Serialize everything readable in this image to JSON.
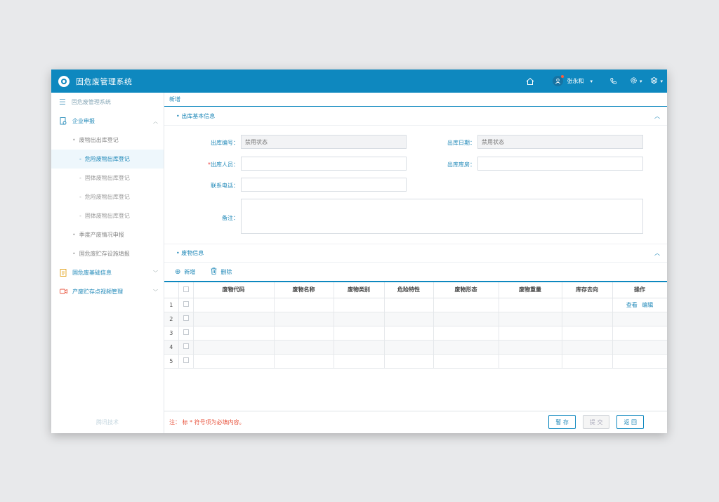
{
  "app": {
    "title": "固危废管理系统"
  },
  "header": {
    "user_name": "张永和",
    "icons": [
      "home-icon",
      "user-icon",
      "phone-icon",
      "settings-icon",
      "layers-icon"
    ]
  },
  "sidebar": {
    "header_label": "固危废管理系统",
    "group1": {
      "label": "企业申报"
    },
    "level2_a": "废物出出库登记",
    "level3": [
      "危险废物出库登记",
      "固体废物出库登记",
      "危险废物出库登记",
      "固体废物出库登记"
    ],
    "level2_b": "季度产废情况申报",
    "level2_c": "固危废贮存设施填报",
    "group2": {
      "label": "固危废基础信息"
    },
    "group3": {
      "label": "产废贮存点视频管理"
    },
    "footer": "腾讯技术"
  },
  "main": {
    "tab_label": "新增",
    "section1_title": "• 出库基本信息",
    "form": {
      "code_label": "出库编号：",
      "code_placeholder": "禁用状态",
      "date_label": "出库日期：",
      "date_placeholder": "禁用状态",
      "person_req": "*",
      "person_label": "出库人员：",
      "warehouse_label": "出库库房：",
      "phone_label": "联系电话：",
      "remark_label": "备注："
    },
    "section2_title": "• 废物信息",
    "toolbar": {
      "add_label": "新增",
      "delete_label": "删除"
    },
    "table": {
      "columns": [
        "废物代码",
        "废物名称",
        "废物类别",
        "危险特性",
        "废物形态",
        "废物重量",
        "库存去向",
        "操作"
      ],
      "rows": [
        "1",
        "2",
        "3",
        "4",
        "5"
      ],
      "op_view": "查看",
      "op_edit": "编辑"
    },
    "footer": {
      "note": "注：  标 * 符号项为必填内容。",
      "save_label": "暂 存",
      "submit_label": "提 交",
      "back_label": "返 回"
    }
  },
  "colors": {
    "primary": "#0e88bf",
    "note": "#e8533c"
  }
}
